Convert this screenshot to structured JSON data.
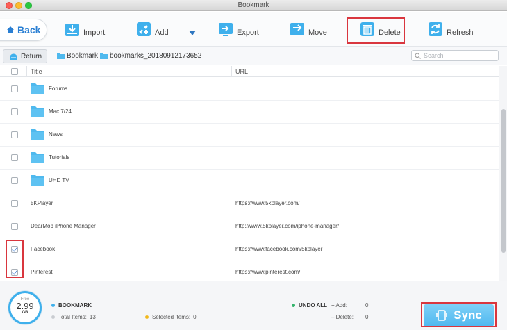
{
  "window": {
    "title": "Bookmark"
  },
  "toolbar": {
    "back_label": "Back",
    "import_label": "Import",
    "add_label": "Add",
    "export_label": "Export",
    "move_label": "Move",
    "delete_label": "Delete",
    "refresh_label": "Refresh"
  },
  "nav": {
    "return_label": "Return",
    "breadcrumb": [
      "Bookmark",
      "bookmarks_20180912173652"
    ],
    "search_placeholder": "Search"
  },
  "table": {
    "columns": [
      "Title",
      "URL"
    ],
    "rows": [
      {
        "type": "folder",
        "title": "Forums",
        "url": "",
        "checked": false
      },
      {
        "type": "folder",
        "title": "Mac 7/24",
        "url": "",
        "checked": false
      },
      {
        "type": "folder",
        "title": "News",
        "url": "",
        "checked": false
      },
      {
        "type": "folder",
        "title": "Tutorials",
        "url": "",
        "checked": false
      },
      {
        "type": "folder",
        "title": "UHD TV",
        "url": "",
        "checked": false
      },
      {
        "type": "link",
        "title": "5KPlayer",
        "url": "https://www.5kplayer.com/",
        "checked": false
      },
      {
        "type": "link",
        "title": "DearMob iPhone Manager",
        "url": "http://www.5kplayer.com/iphone-manager/",
        "checked": false
      },
      {
        "type": "link",
        "title": "Facebook",
        "url": "https://www.facebook.com/5kplayer",
        "checked": true
      },
      {
        "type": "link",
        "title": "Pinterest",
        "url": "https://www.pinterest.com/",
        "checked": true
      }
    ]
  },
  "footer": {
    "disk_free_label": "Free",
    "disk_free_value": "2.99",
    "disk_unit": "GB",
    "bookmark_label": "BOOKMARK",
    "total_items_label": "Total Items:",
    "total_items_value": "13",
    "selected_items_label": "Selected Items:",
    "selected_items_value": "0",
    "undo_all_label": "UNDO ALL",
    "add_label": "+ Add:",
    "add_value": "0",
    "delete_label": "–  Delete:",
    "delete_value": "0",
    "sync_label": "Sync"
  },
  "colors": {
    "accent_blue": "#2a7fd3",
    "folder_blue": "#4fb9ee",
    "highlight_red": "#d9363e",
    "sync_blue": "#4fb8ef",
    "undo_green": "#34b36c",
    "selected_yellow": "#f2b81b"
  }
}
